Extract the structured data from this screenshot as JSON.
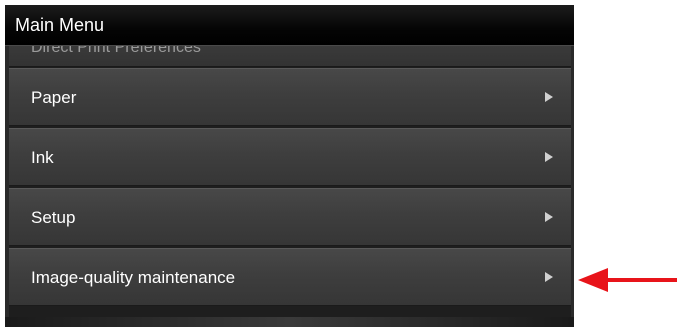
{
  "title_bar": {
    "title": "Main Menu"
  },
  "menu": {
    "partially_hidden_item": "Direct Print Preferences",
    "items": [
      {
        "label": "Paper",
        "icon": "chevron-right-icon"
      },
      {
        "label": "Ink",
        "icon": "chevron-right-icon"
      },
      {
        "label": "Setup",
        "icon": "chevron-right-icon"
      },
      {
        "label": "Image-quality maintenance",
        "icon": "chevron-right-icon"
      }
    ]
  },
  "annotation": {
    "arrow_color": "#e8141a",
    "points_to": "Image-quality maintenance"
  },
  "colors": {
    "title_bar_bg": "#000000",
    "item_bg": "#404040",
    "text": "#ffffff"
  }
}
